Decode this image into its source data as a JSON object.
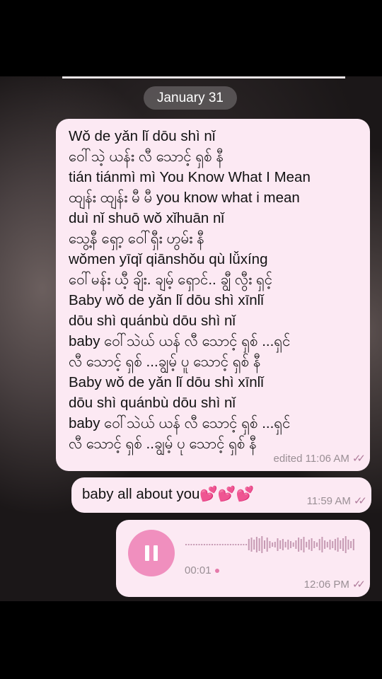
{
  "date_separator": "January 31",
  "message_lyrics": {
    "lines": [
      "Wǒ de yǎn lǐ dōu shì nǐ",
      "ဝေါ်သဲ့ ယန်း လီ သောင့် ရှစ် နီ",
      "tián tiánmì mì You Know What I Mean",
      "ထျန်း ထျန်း မီ မီ you know what i mean",
      "duì nǐ shuō wǒ xǐhuān nǐ",
      "သွေ့နီ ရှော့ ဝေါ်ရှီး ဟွမ်း နီ",
      "wǒmen yīqǐ qiānshǒu qù lǚxíng",
      "ဝေါ်မန်း ယီ့ ချိး. ချမ့် ရှောင်.. ချွီ လွီး ရှင့်",
      "Baby wǒ de yǎn lǐ dōu shì xīnlǐ",
      "dōu shì quánbù dōu shì nǐ",
      "baby ဝေါ်သဲယ် ယန် လီ သောင့် ရှစ် ...ရှင်",
      "လီ သောင့် ရှစ် ...ချွမ့် ပူ သောင့် ရှစ် နီ",
      "Baby wǒ de yǎn lǐ dōu shì xīnlǐ",
      "dōu shì quánbù dōu shì nǐ",
      "baby ဝေါ်သဲယ် ယန် လီ သောင့် ရှစ် ...ရှင်",
      "လီ သောင့် ရှစ် ..ချွမ့် ပု သောင့် ရှစ် နီ"
    ],
    "status": "edited 11:06 AM",
    "read_receipt": "✓✓"
  },
  "message_text": {
    "text": "baby all about you💕💕💕",
    "time": "11:59 AM",
    "read_receipt": "✓✓"
  },
  "message_voice": {
    "play_state_icon": "pause-icon",
    "duration": "00:01",
    "time": "12:06 PM",
    "read_receipt": "✓✓"
  },
  "colors": {
    "bubble": "#fce9f3",
    "accent_pink": "#f08fbe",
    "timestamp": "#9a8f95",
    "ticks": "#b07d9c"
  }
}
